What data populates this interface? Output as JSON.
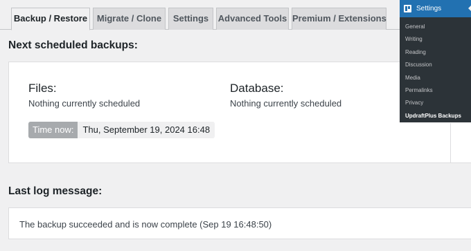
{
  "tabs": [
    {
      "label": "Backup / Restore",
      "active": true
    },
    {
      "label": "Migrate / Clone"
    },
    {
      "label": "Settings"
    },
    {
      "label": "Advanced Tools"
    },
    {
      "label": "Premium / Extensions"
    }
  ],
  "scheduled": {
    "heading": "Next scheduled backups:",
    "files_title": "Files:",
    "files_status": "Nothing currently scheduled",
    "database_title": "Database:",
    "database_status": "Nothing currently scheduled",
    "time_now_label": "Time now:",
    "time_now_value": "Thu, September 19, 2024 16:48"
  },
  "log": {
    "heading": "Last log message:",
    "message": "The backup succeeded and is now complete (Sep 19 16:48:50)"
  },
  "admin_menu": {
    "title": "Settings",
    "icon": "settings-icon",
    "items": [
      "General",
      "Writing",
      "Reading",
      "Discussion",
      "Media",
      "Permalinks",
      "Privacy",
      "UpdraftPlus Backups"
    ],
    "current_index": 7
  }
}
